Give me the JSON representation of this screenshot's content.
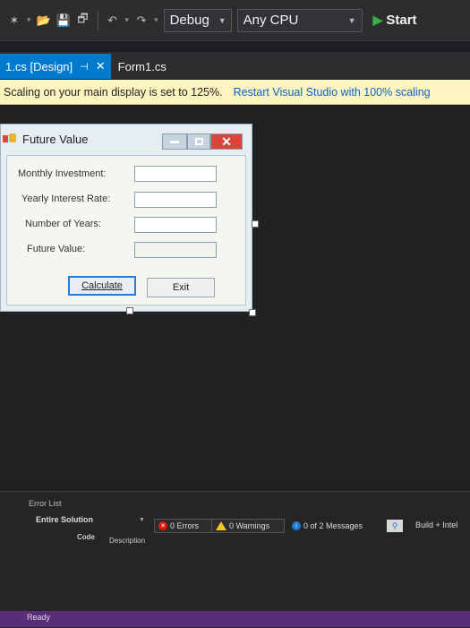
{
  "toolbar": {
    "configuration": "Debug",
    "platform": "Any CPU",
    "start_label": "Start"
  },
  "tabs": {
    "active": "1.cs [Design]",
    "inactive": "Form1.cs"
  },
  "infobar": {
    "message": "Scaling on your main display is set to 125%.",
    "action": "Restart Visual Studio with 100% scaling"
  },
  "form": {
    "title": "Future Value",
    "fields": [
      {
        "label": "Monthly Investment:",
        "value": ""
      },
      {
        "label": "Yearly Interest Rate:",
        "value": ""
      },
      {
        "label": "Number of Years:",
        "value": ""
      },
      {
        "label": "Future Value:",
        "value": ""
      }
    ],
    "calculate_label": "Calculate",
    "exit_label": "Exit"
  },
  "error_list": {
    "title": "Error List",
    "scope": "Entire Solution",
    "errors": "0 Errors",
    "warnings": "0 Warnings",
    "messages": "0 of 2 Messages",
    "build_filter": "Build + Intel",
    "columns": {
      "code": "Code",
      "description": "Description"
    }
  },
  "status": {
    "text": "Ready"
  },
  "colors": {
    "accent": "#007acc",
    "infobar": "#fdf4bf",
    "close": "#d9453a"
  }
}
